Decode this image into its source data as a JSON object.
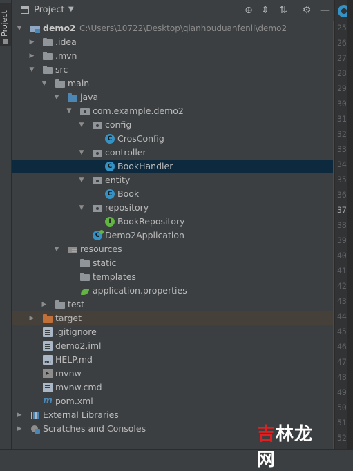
{
  "side_tab": {
    "label": "Project"
  },
  "toolbar": {
    "title": "Project",
    "buttons": [
      "locate-icon",
      "expand-all-icon",
      "collapse-all-icon",
      "gear-icon",
      "minimize-icon"
    ]
  },
  "tree": [
    {
      "depth": 0,
      "arrow": "down",
      "icon": "module",
      "label": "demo2",
      "bold": true,
      "path": "C:\\Users\\10722\\Desktop\\qianhouduanfenli\\demo2"
    },
    {
      "depth": 1,
      "arrow": "right",
      "icon": "folder",
      "label": ".idea"
    },
    {
      "depth": 1,
      "arrow": "right",
      "icon": "folder",
      "label": ".mvn"
    },
    {
      "depth": 1,
      "arrow": "down",
      "icon": "folder",
      "label": "src"
    },
    {
      "depth": 2,
      "arrow": "down",
      "icon": "folder",
      "label": "main"
    },
    {
      "depth": 3,
      "arrow": "down",
      "icon": "folder-blue",
      "label": "java"
    },
    {
      "depth": 4,
      "arrow": "down",
      "icon": "pkg",
      "label": "com.example.demo2"
    },
    {
      "depth": 5,
      "arrow": "down",
      "icon": "pkg",
      "label": "config"
    },
    {
      "depth": 6,
      "arrow": "",
      "icon": "class",
      "label": "CrosConfig"
    },
    {
      "depth": 5,
      "arrow": "down",
      "icon": "pkg",
      "label": "controller"
    },
    {
      "depth": 6,
      "arrow": "",
      "icon": "class",
      "label": "BookHandler",
      "selected": true
    },
    {
      "depth": 5,
      "arrow": "down",
      "icon": "pkg",
      "label": "entity"
    },
    {
      "depth": 6,
      "arrow": "",
      "icon": "class",
      "label": "Book"
    },
    {
      "depth": 5,
      "arrow": "down",
      "icon": "pkg",
      "label": "repository"
    },
    {
      "depth": 6,
      "arrow": "",
      "icon": "iface",
      "label": "BookRepository"
    },
    {
      "depth": 5,
      "arrow": "",
      "icon": "app",
      "label": "Demo2Application"
    },
    {
      "depth": 3,
      "arrow": "down",
      "icon": "res",
      "label": "resources"
    },
    {
      "depth": 4,
      "arrow": "",
      "icon": "folder",
      "label": "static"
    },
    {
      "depth": 4,
      "arrow": "",
      "icon": "folder",
      "label": "templates"
    },
    {
      "depth": 4,
      "arrow": "",
      "icon": "leaf",
      "label": "application.properties"
    },
    {
      "depth": 2,
      "arrow": "right",
      "icon": "folder",
      "label": "test"
    },
    {
      "depth": 1,
      "arrow": "right",
      "icon": "folder-orange",
      "label": "target",
      "highlight": true
    },
    {
      "depth": 1,
      "arrow": "",
      "icon": "file",
      "label": ".gitignore"
    },
    {
      "depth": 1,
      "arrow": "",
      "icon": "file",
      "label": "demo2.iml"
    },
    {
      "depth": 1,
      "arrow": "",
      "icon": "md",
      "label": "HELP.md"
    },
    {
      "depth": 1,
      "arrow": "",
      "icon": "term",
      "label": "mvnw"
    },
    {
      "depth": 1,
      "arrow": "",
      "icon": "file",
      "label": "mvnw.cmd"
    },
    {
      "depth": 1,
      "arrow": "",
      "icon": "maven",
      "label": "pom.xml"
    },
    {
      "depth": 0,
      "arrow": "right",
      "icon": "lib",
      "label": "External Libraries"
    },
    {
      "depth": 0,
      "arrow": "right",
      "icon": "scratch",
      "label": "Scratches and Consoles"
    }
  ],
  "gutter": {
    "lines": [
      "25",
      "26",
      "27",
      "28",
      "29",
      "30",
      "31",
      "32",
      "33",
      "34",
      "35",
      "36",
      "37",
      "38",
      "39",
      "40",
      "41",
      "42",
      "43",
      "44",
      "45",
      "46",
      "47",
      "48",
      "49",
      "50",
      "51",
      "52"
    ],
    "current": "37"
  },
  "watermark": {
    "part1": "吉",
    "part2": "林龙网"
  },
  "colors": {
    "selected": "#0d293e",
    "highlight": "#45403a",
    "accent": "#3592c4"
  }
}
